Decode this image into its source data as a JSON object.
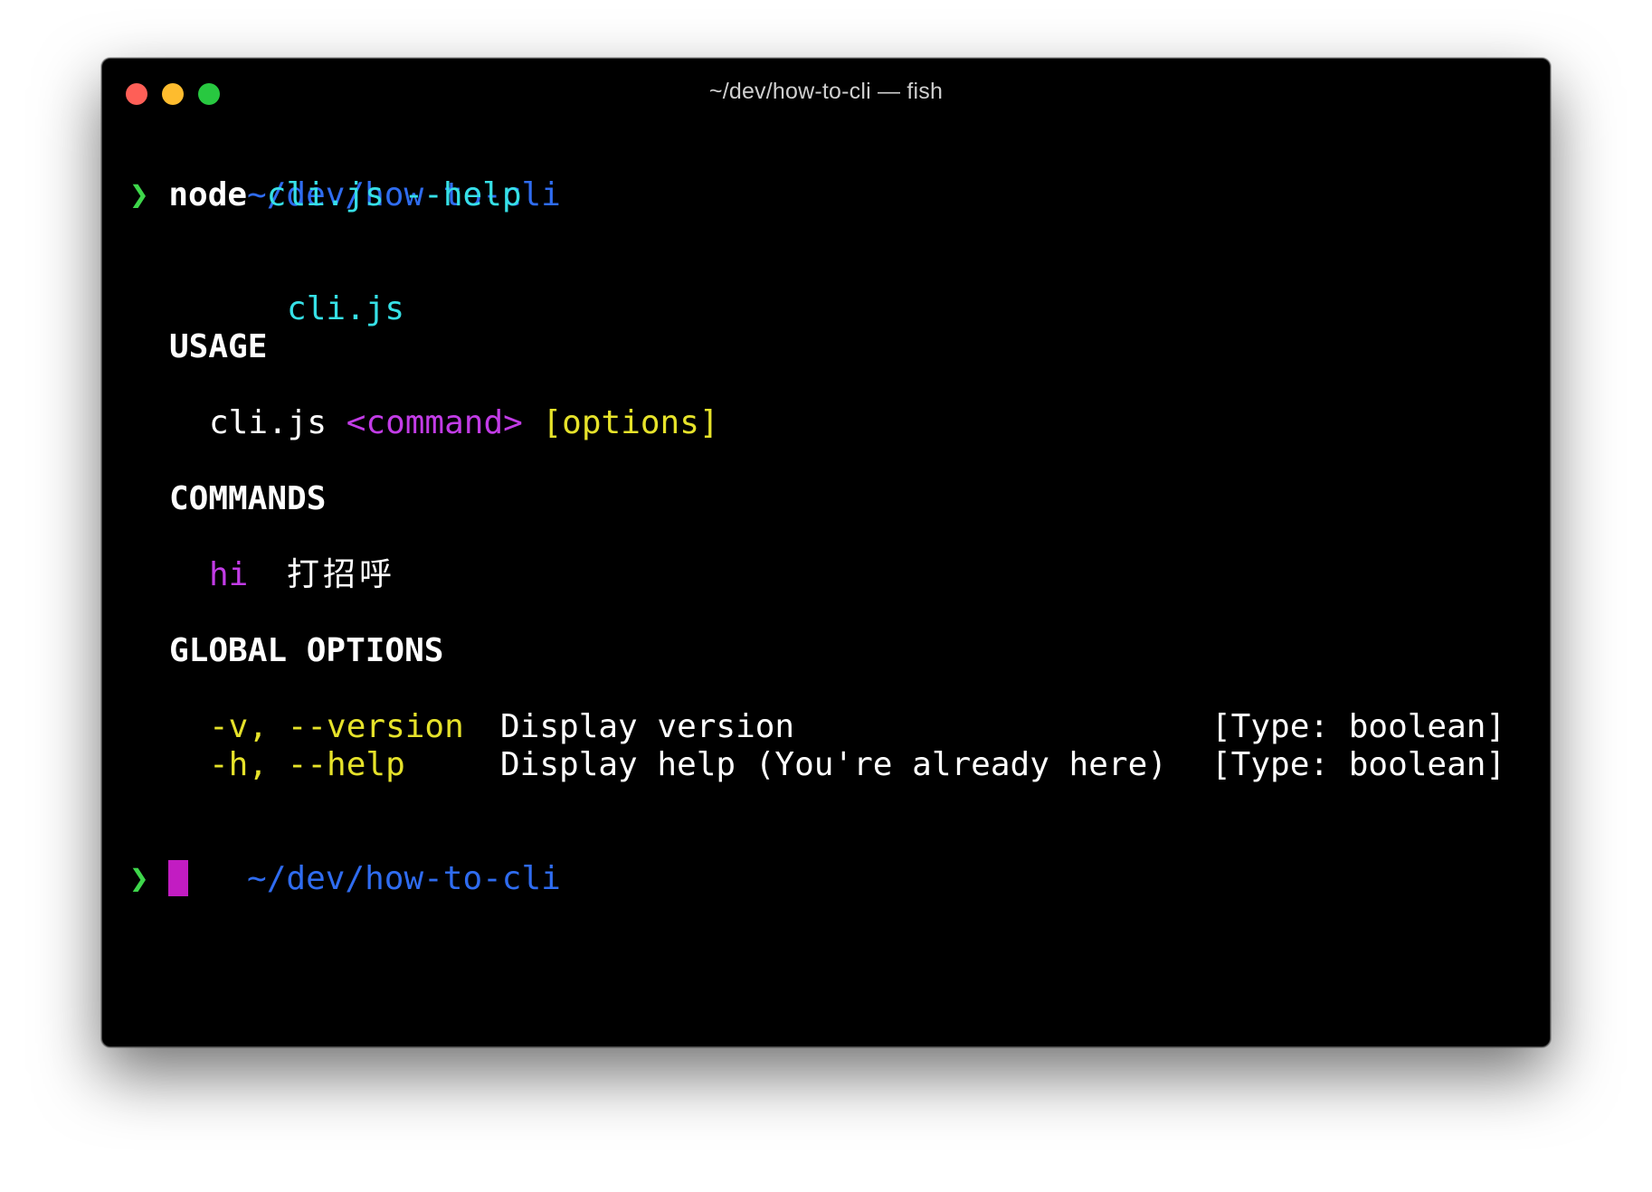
{
  "window": {
    "title": "~/dev/how-to-cli — fish",
    "traffic_lights": {
      "close_color": "#fe5f57",
      "minimize_color": "#febc2e",
      "zoom_color": "#28c840"
    }
  },
  "colors": {
    "background": "#000000",
    "path": "#2f6cf0",
    "prompt_symbol": "#3ed64b",
    "command": "#ffffff",
    "argument": "#36e0e6",
    "title_text": "#36e0e6",
    "heading": "#ffffff",
    "placeholder_command": "#c23ce6",
    "placeholder_options": "#e6e22a",
    "option_flag": "#e6e22a",
    "cursor": "#c21cc2",
    "plain_text": "#ffffff"
  },
  "terminal": {
    "prompt1": {
      "path": "~/dev/how-to-cli",
      "symbol": "❯",
      "command": "node",
      "args": "cli.js --help"
    },
    "output": {
      "name": "cli.js",
      "usage_heading": "USAGE",
      "usage": {
        "program": "cli.js",
        "command_placeholder": "<command>",
        "options_placeholder": "[options]"
      },
      "commands_heading": "COMMANDS",
      "commands": [
        {
          "name": "hi",
          "description": "打招呼"
        }
      ],
      "global_options_heading": "GLOBAL OPTIONS",
      "options": [
        {
          "flags": "-v, --version",
          "description": "Display version",
          "type": "[Type: boolean]"
        },
        {
          "flags": "-h, --help",
          "description": "Display help (You're already here)",
          "type": "[Type: boolean]"
        }
      ]
    },
    "prompt2": {
      "path": "~/dev/how-to-cli",
      "symbol": "❯"
    }
  }
}
